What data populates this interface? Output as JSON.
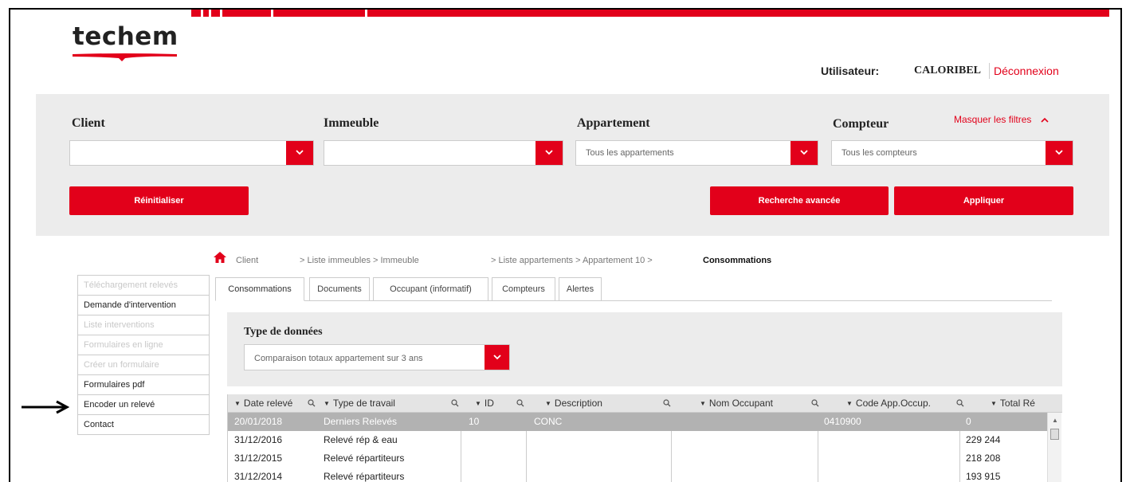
{
  "brand": {
    "logo_text": "techem",
    "accent": "#e2001a"
  },
  "user": {
    "label": "Utilisateur:",
    "name": "CALORIBEL",
    "logout": "Déconnexion"
  },
  "filters": {
    "hide_label": "Masquer les filtres",
    "client": {
      "label": "Client",
      "value": ""
    },
    "immeuble": {
      "label": "Immeuble",
      "value": ""
    },
    "appartement": {
      "label": "Appartement",
      "value": "Tous les appartements"
    },
    "compteur": {
      "label": "Compteur",
      "value": "Tous les compteurs"
    },
    "reset": "Réinitialiser",
    "advanced": "Recherche avancée",
    "apply": "Appliquer"
  },
  "breadcrumb": {
    "client": "Client",
    "immeubles": "> Liste immeubles > Immeuble",
    "appartements": "> Liste appartements > Appartement 10 >",
    "current": "Consommations"
  },
  "sidebar": {
    "items": [
      {
        "label": "Téléchargement relevés",
        "enabled": false
      },
      {
        "label": "Demande d'intervention",
        "enabled": true
      },
      {
        "label": "Liste interventions",
        "enabled": false
      },
      {
        "label": "Formulaires en ligne",
        "enabled": false
      },
      {
        "label": "Créer un formulaire",
        "enabled": false
      },
      {
        "label": "Formulaires pdf",
        "enabled": true
      },
      {
        "label": "Encoder un relevé",
        "enabled": true
      },
      {
        "label": "Contact",
        "enabled": true
      }
    ]
  },
  "tabs": [
    "Consommations",
    "Documents",
    "Occupant (informatif)",
    "Compteurs",
    "Alertes"
  ],
  "data_type": {
    "label": "Type de données",
    "value": "Comparaison totaux appartement sur 3 ans"
  },
  "table": {
    "columns": [
      "Date relevé",
      "Type de travail",
      "ID",
      "Description",
      "Nom Occupant",
      "Code App.Occup.",
      "Total Ré"
    ],
    "rows": [
      {
        "date": "20/01/2018",
        "type": "Derniers Relevés",
        "id": "10",
        "description": "CONC",
        "occupant": "",
        "code": "0410900",
        "total": "0",
        "selected": true
      },
      {
        "date": "31/12/2016",
        "type": "Relevé rép & eau",
        "id": "",
        "description": "",
        "occupant": "",
        "code": "",
        "total": "229 244",
        "selected": false
      },
      {
        "date": "31/12/2015",
        "type": "Relevé répartiteurs",
        "id": "",
        "description": "",
        "occupant": "",
        "code": "",
        "total": "218 208",
        "selected": false
      },
      {
        "date": "31/12/2014",
        "type": "Relevé répartiteurs",
        "id": "",
        "description": "",
        "occupant": "",
        "code": "",
        "total": "193 915",
        "selected": false
      }
    ]
  }
}
